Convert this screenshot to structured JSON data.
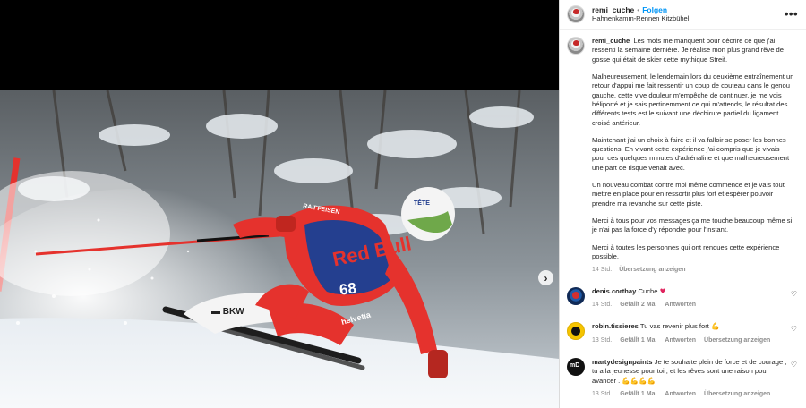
{
  "header": {
    "username": "remi_cuche",
    "separator": "•",
    "follow_label": "Folgen",
    "location": "Hahnenkamm-Rennen Kitzbühel",
    "more_icon": "more-horizontal-icon"
  },
  "media": {
    "next_icon": "chevron-right-icon",
    "bib_number": "68",
    "suit_text_1": "Red Bull",
    "suit_text_2": "RAIFFEISEN",
    "suit_text_3": "BKW",
    "suit_text_4": "helvetia",
    "suit_text_5": "TETE DE MOINE",
    "colors": {
      "suit_red": "#e5322d",
      "bib_blue": "#243f8f",
      "snow": "#f1f4f8"
    }
  },
  "caption": {
    "username": "remi_cuche",
    "paragraphs": [
      "Les mots me manquent pour décrire ce que j'ai ressenti la semaine dernière. Je réalise mon plus grand rêve de gosse qui était de skier cette mythique Streif.",
      "Malheureusement, le lendemain lors du deuxième entraînement un retour d'appui me fait ressentir un coup de couteau dans le genou gauche, cette vive douleur m'empêche de continuer, je me vois héliporté et je sais pertinemment ce qui m'attends, le résultat des différents tests est le suivant une déchirure partiel du ligament croisé antérieur.",
      "Maintenant j'ai un choix à faire et il va falloir se poser les bonnes questions. En vivant cette expérience j'ai compris que je vivais pour ces quelques minutes d'adrénaline et que malheureusement une part de risque venait avec.",
      "Un nouveau combat contre moi même commence et je vais tout mettre en place pour en ressortir plus fort et espérer pouvoir prendre ma revanche sur cette piste.",
      "Merci à tous pour vos messages ça me touche beaucoup même si je n'ai pas la force d'y répondre pour l'instant.",
      "Merci à toutes les personnes qui ont rendues cette expérience possible."
    ],
    "time": "14 Std.",
    "see_translation": "Übersetzung anzeigen"
  },
  "comments": [
    {
      "username": "denis.corthay",
      "text": "Cuche",
      "emoji": "♥",
      "time": "14 Std.",
      "likes": "Gefällt 2 Mal",
      "reply": "Antworten",
      "translate": ""
    },
    {
      "username": "robin.tissieres",
      "text": "Tu vas revenir plus fort",
      "emoji": "💪",
      "time": "13 Std.",
      "likes": "Gefällt 1 Mal",
      "reply": "Antworten",
      "translate": "Übersetzung anzeigen"
    },
    {
      "username": "martydesignpaints",
      "text": "Je te souhaite plein de force et de courage , tu a la jeunesse pour toi , et les rêves sont une raison pour avancer .",
      "emoji": "💪💪💪💪",
      "time": "13 Std.",
      "likes": "Gefällt 1 Mal",
      "reply": "Antworten",
      "translate": "Übersetzung anzeigen"
    }
  ]
}
